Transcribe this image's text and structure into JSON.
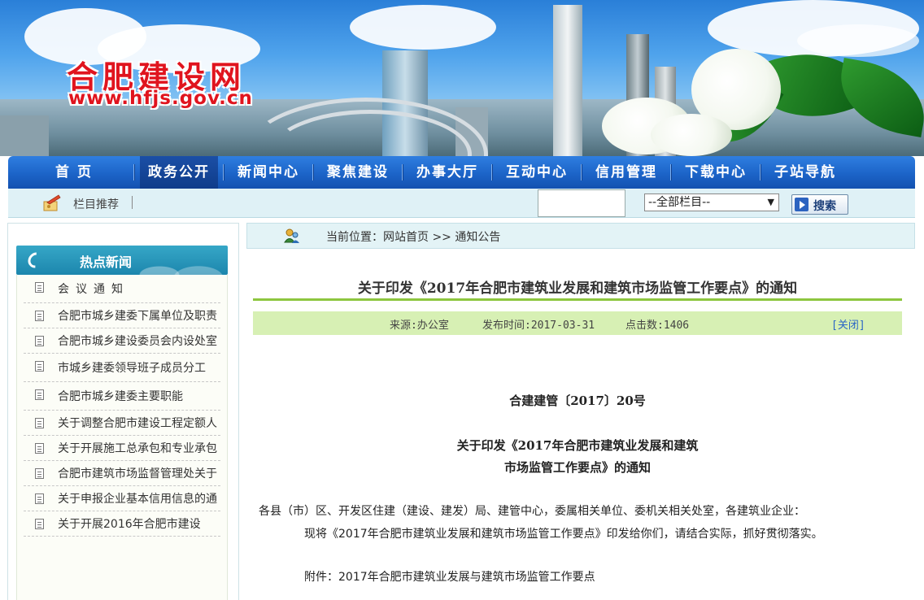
{
  "site": {
    "name": "合肥建设网",
    "url": "www.hfjs.gov.cn"
  },
  "nav": {
    "items": [
      "首页",
      "政务公开",
      "新闻中心",
      "聚焦建设",
      "办事大厅",
      "互动中心",
      "信用管理",
      "下载中心",
      "子站导航"
    ],
    "active": "政务公开"
  },
  "subbar": {
    "recommend_label": "栏目推荐",
    "search_value": "",
    "select_value": "--全部栏目--",
    "search_button": "搜索"
  },
  "sidebar": {
    "title": "热点新闻",
    "items": [
      "会议通知",
      "合肥市城乡建委下属单位及职责",
      "合肥市城乡建设委员会内设处室",
      "市城乡建委领导班子成员分工",
      "合肥市城乡建委主要职能",
      "关于调整合肥市建设工程定额人",
      "关于开展施工总承包和专业承包",
      "合肥市建筑市场监督管理处关于",
      "关于申报企业基本信用信息的通",
      "关于开展2016年合肥市建设"
    ]
  },
  "breadcrumb": {
    "prefix": "当前位置：",
    "home": "网站首页",
    "sep": " >> ",
    "current": "通知公告"
  },
  "article": {
    "title": "关于印发《2017年合肥市建筑业发展和建筑市场监管工作要点》的通知",
    "source": "来源:办公室",
    "date": "发布时间:2017-03-31",
    "clicks": "点击数:1406",
    "close": "[关闭]",
    "doc_no": "合建建管〔2017〕20号",
    "sub_title_1": "关于印发《2017年合肥市建筑业发展和建筑",
    "sub_title_2": "市场监管工作要点》的通知",
    "para_1": "各县（市）区、开发区住建（建设、建发）局、建管中心，委属相关单位、委机关相关处室，各建筑业企业：",
    "para_2": "现将《2017年合肥市建筑业发展和建筑市场监管工作要点》印发给你们，请结合实际，抓好贯彻落实。",
    "para_3": "附件：2017年合肥市建筑业发展与建筑市场监管工作要点"
  }
}
